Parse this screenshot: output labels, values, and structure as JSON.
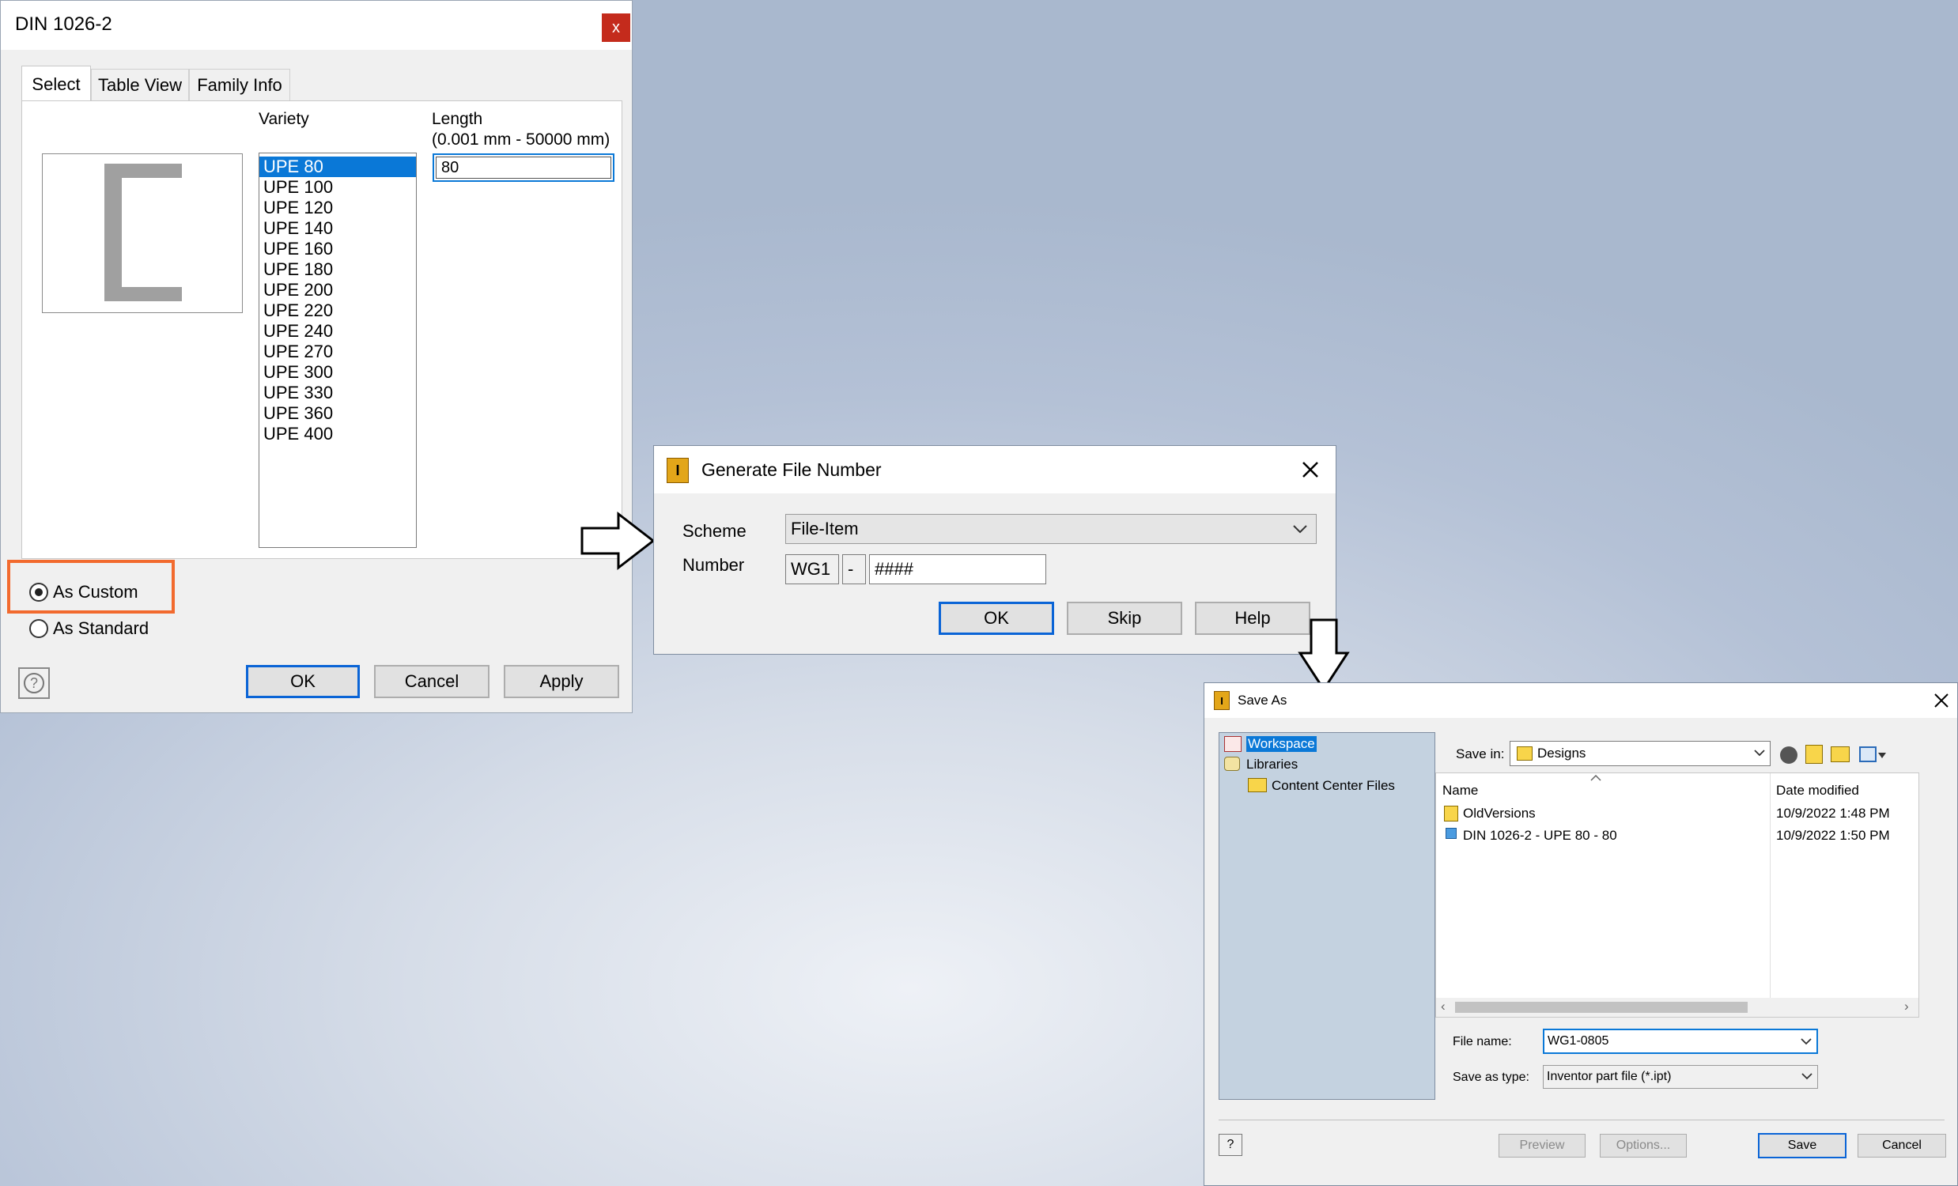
{
  "dialog1": {
    "title": "DIN 1026-2",
    "close_label": "x",
    "tabs": [
      "Select",
      "Table View",
      "Family Info"
    ],
    "variety_label": "Variety",
    "length_label_line1": "Length",
    "length_label_line2": "(0.001 mm - 50000 mm)",
    "length_value": "80",
    "variety_items": [
      "UPE 80",
      "UPE 100",
      "UPE 120",
      "UPE 140",
      "UPE 160",
      "UPE 180",
      "UPE 200",
      "UPE 220",
      "UPE 240",
      "UPE 270",
      "UPE 300",
      "UPE 330",
      "UPE 360",
      "UPE 400"
    ],
    "selected_variety": "UPE 80",
    "radio_custom": "As Custom",
    "radio_standard": "As Standard",
    "selected_radio": "As Custom",
    "buttons": {
      "ok": "OK",
      "cancel": "Cancel",
      "apply": "Apply"
    },
    "help_icon": "question-circle-icon"
  },
  "dialog2": {
    "title": "Generate File Number",
    "scheme_label": "Scheme",
    "scheme_value": "File-Item",
    "number_label": "Number",
    "number_prefix": "WG1",
    "number_separator": "-",
    "number_pattern": "####",
    "buttons": {
      "ok": "OK",
      "skip": "Skip",
      "help": "Help"
    }
  },
  "dialog3": {
    "title": "Save As",
    "tree": {
      "workspace": "Workspace",
      "libraries": "Libraries",
      "content_center": "Content Center Files"
    },
    "save_in_label": "Save in:",
    "save_in_value": "Designs",
    "columns": {
      "name": "Name",
      "date": "Date modified"
    },
    "files": [
      {
        "name": "OldVersions",
        "date": "10/9/2022 1:48 PM",
        "icon": "folder-icon"
      },
      {
        "name": "DIN 1026-2 - UPE 80 - 80",
        "date": "10/9/2022 1:50 PM",
        "icon": "part-file-icon"
      }
    ],
    "file_name_label": "File name:",
    "file_name_value": "WG1-0805",
    "save_type_label": "Save as type:",
    "save_type_value": "Inventor part file (*.ipt)",
    "buttons": {
      "preview": "Preview",
      "options": "Options...",
      "save": "Save",
      "cancel": "Cancel"
    }
  },
  "colors": {
    "accent": "#0a78d7",
    "highlight_box": "#f26a2e",
    "close_red": "#c42b1c"
  }
}
